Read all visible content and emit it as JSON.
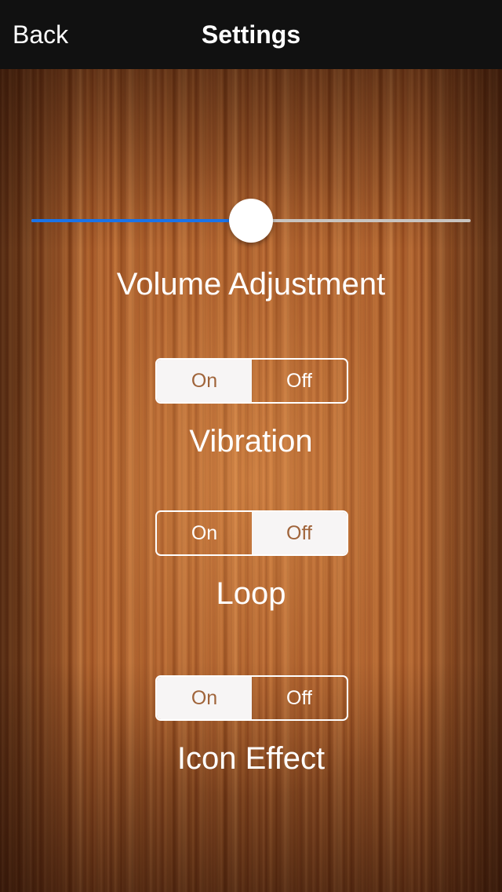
{
  "navbar": {
    "back_label": "Back",
    "title": "Settings"
  },
  "volume": {
    "label": "Volume Adjustment",
    "value_percent": 50,
    "fill_color": "#1a73e8",
    "track_color": "#c8c4c0"
  },
  "settings": [
    {
      "label": "Vibration",
      "on_label": "On",
      "off_label": "Off",
      "selected": "on"
    },
    {
      "label": "Loop",
      "on_label": "On",
      "off_label": "Off",
      "selected": "off"
    },
    {
      "label": "Icon Effect",
      "on_label": "On",
      "off_label": "Off",
      "selected": "on"
    }
  ],
  "colors": {
    "navbar_bg": "#111111",
    "segment_active_bg": "#f7f5f5",
    "segment_active_text": "#a0643a"
  }
}
